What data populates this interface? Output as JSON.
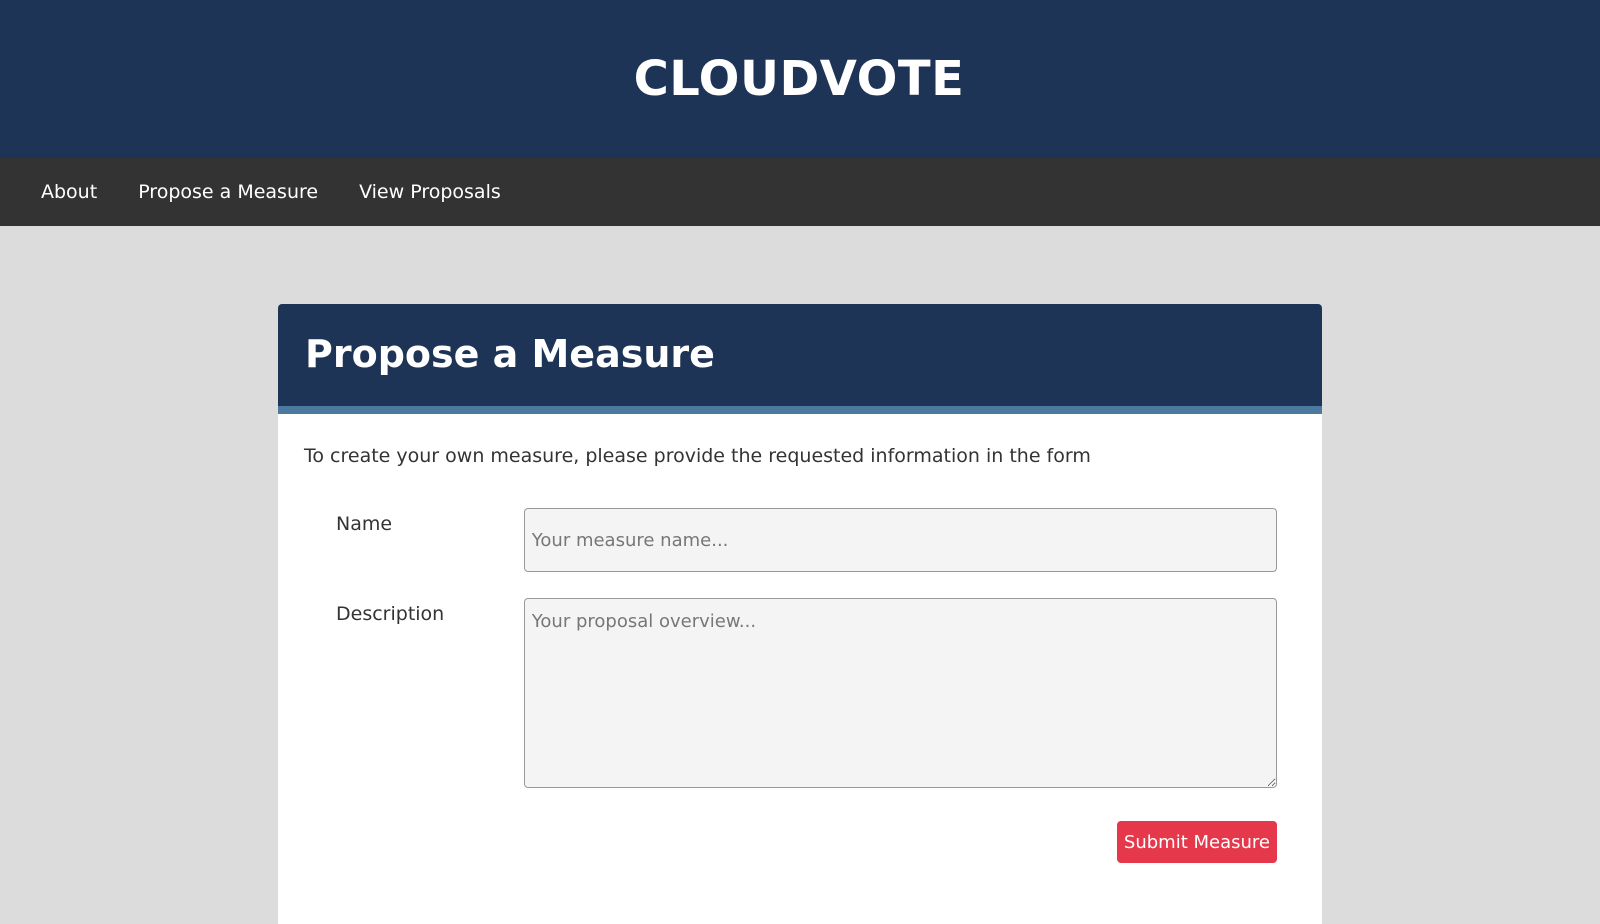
{
  "site": {
    "title": "CLOUDVOTE"
  },
  "nav": {
    "items": [
      {
        "label": "About"
      },
      {
        "label": "Propose a Measure"
      },
      {
        "label": "View Proposals"
      }
    ]
  },
  "form": {
    "title": "Propose a Measure",
    "intro": "To create your own measure, please provide the requested information in the form",
    "name_label": "Name",
    "name_value": "",
    "name_placeholder": "Your measure name...",
    "description_label": "Description",
    "description_value": "",
    "description_placeholder": "Your proposal overview...",
    "submit_label": "Submit Measure"
  },
  "colors": {
    "header_bg": "#1e3457",
    "nav_bg": "#333333",
    "page_bg": "#dcdcdc",
    "card_accent": "#4b7a9e",
    "submit_bg": "#e5384b"
  }
}
